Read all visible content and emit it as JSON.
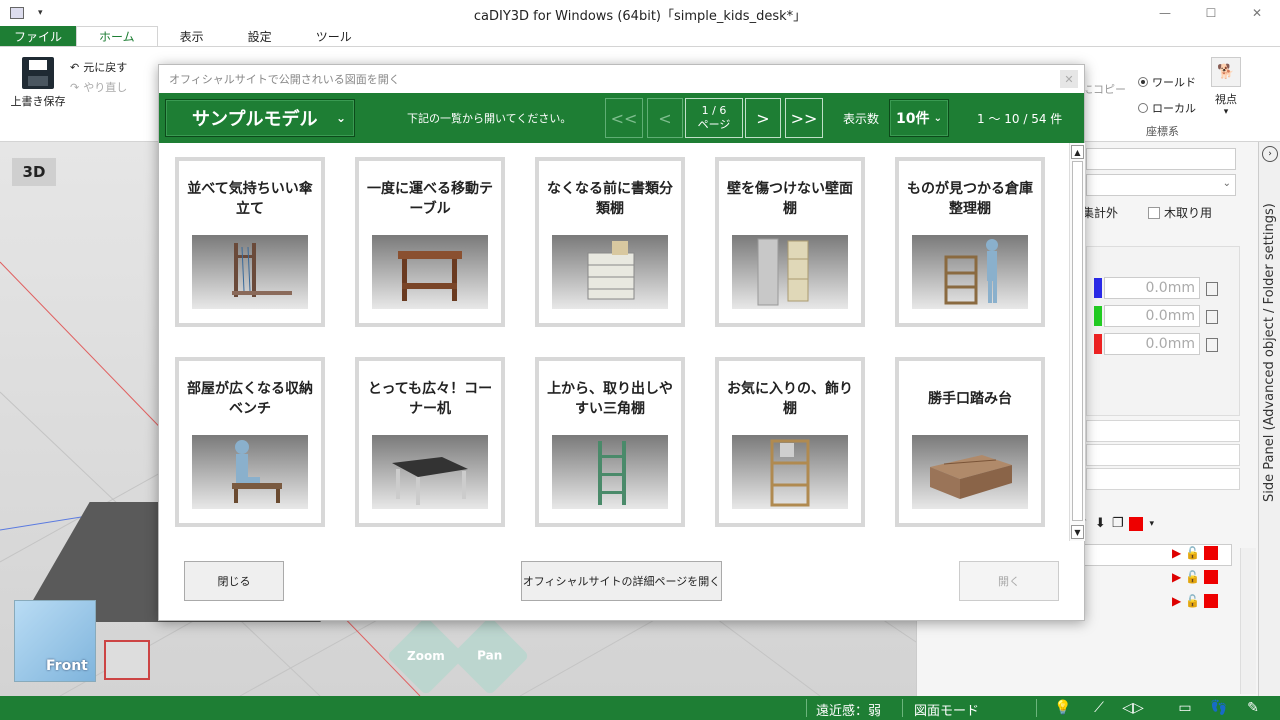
{
  "window": {
    "title": "caDIY3D for Windows (64bit)「simple_kids_desk*」",
    "controls": [
      "—",
      "☐",
      "✕"
    ]
  },
  "ribbon": {
    "tabs": [
      "ファイル",
      "ホーム",
      "表示",
      "設定",
      "ツール"
    ],
    "save_label": "上書き保存",
    "undo_label": "元に戻す",
    "redo_label": "やり直し",
    "coord_world": "ワールド",
    "coord_local": "ローカル",
    "coord_group": "座標系",
    "viewpoint_label": "視点",
    "copy_hint": "にコピー"
  },
  "viewport": {
    "label": "3D",
    "cube_face": "Front",
    "zoom_label": "Zoom",
    "pan_label": "Pan"
  },
  "sidepanel": {
    "vertical_title": "Side Panel (Advanced object / Folder settings)",
    "chk_exclude": "集計外",
    "chk_wood": "木取り用",
    "x_value": "0.0mm",
    "y_value": "0.0mm",
    "z_value": "0.0mm",
    "colors": {
      "x": "#2a2ae8",
      "y": "#22cc22",
      "z": "#ee2222"
    }
  },
  "statusbar": {
    "perspective": "遠近感：弱",
    "mode": "図面モード"
  },
  "modal": {
    "title": "オフィシャルサイトで公開されいる図面を開く",
    "category": "サンプルモデル",
    "note": "下記の一覧から開いてください。",
    "first_btn": "<<",
    "prev_btn": "<",
    "page_info": "1 / 6",
    "page_unit": "ページ",
    "next_btn": ">",
    "last_btn": ">>",
    "per_page_label": "表示数",
    "per_page_value": "10件",
    "range": "1 ～ 10 / 54 件",
    "items": [
      {
        "title": "並べて気持ちいい傘立て"
      },
      {
        "title": "一度に運べる移動テーブル"
      },
      {
        "title": "なくなる前に書類分類棚"
      },
      {
        "title": "壁を傷つけない壁面棚"
      },
      {
        "title": "ものが見つかる倉庫整理棚"
      },
      {
        "title": "部屋が広くなる収納ベンチ"
      },
      {
        "title": "とっても広々！コーナー机"
      },
      {
        "title": "上から、取り出しやすい三角棚"
      },
      {
        "title": "お気に入りの、飾り棚"
      },
      {
        "title": "勝手口踏み台"
      }
    ],
    "close_btn": "閉じる",
    "official_btn": "オフィシャルサイトの詳細ページを開く",
    "open_btn": "開く"
  }
}
